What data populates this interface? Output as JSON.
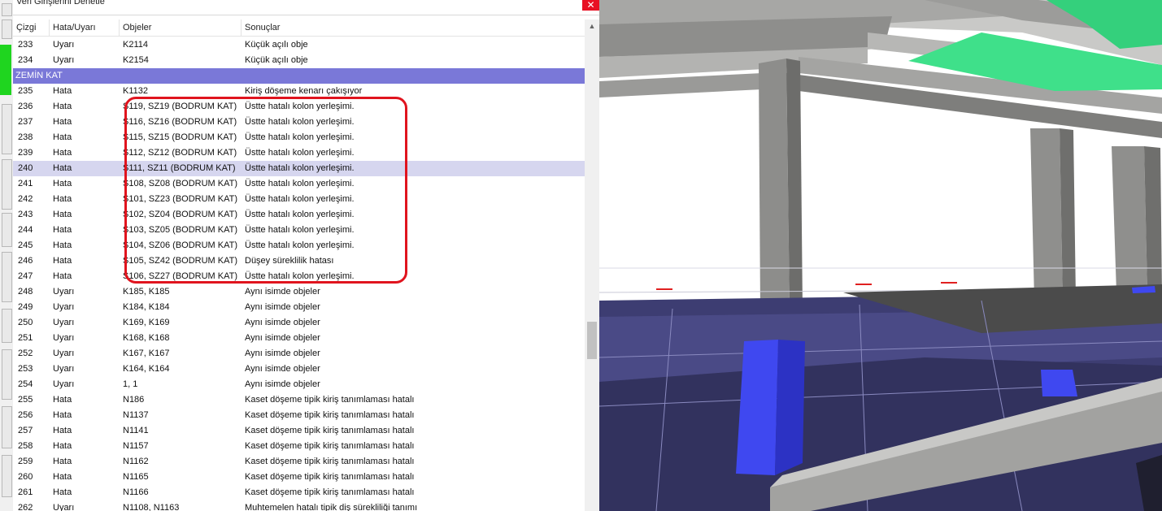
{
  "window": {
    "title": "Veri Girişlerini Denetle",
    "close_glyph": "✕"
  },
  "columns": [
    "Çizgi",
    "Hata/Uyarı",
    "Objeler",
    "Sonuçlar"
  ],
  "rows": [
    {
      "no": "233",
      "type": "Uyarı",
      "objects": "K2114",
      "result": "Küçük açılı obje"
    },
    {
      "no": "234",
      "type": "Uyarı",
      "objects": "K2154",
      "result": "Küçük açılı obje"
    },
    {
      "section": "ZEMİN KAT"
    },
    {
      "no": "235",
      "type": "Hata",
      "objects": "K1132",
      "result": "Kiriş döşeme kenarı çakışıyor"
    },
    {
      "no": "236",
      "type": "Hata",
      "objects": "S119, SZ19 (BODRUM  KAT)",
      "result": "Üstte hatalı kolon yerleşimi."
    },
    {
      "no": "237",
      "type": "Hata",
      "objects": "S116, SZ16 (BODRUM  KAT)",
      "result": "Üstte hatalı kolon yerleşimi."
    },
    {
      "no": "238",
      "type": "Hata",
      "objects": "S115, SZ15 (BODRUM  KAT)",
      "result": "Üstte hatalı kolon yerleşimi."
    },
    {
      "no": "239",
      "type": "Hata",
      "objects": "S112, SZ12 (BODRUM  KAT)",
      "result": "Üstte hatalı kolon yerleşimi."
    },
    {
      "no": "240",
      "type": "Hata",
      "objects": "S111, SZ11 (BODRUM  KAT)",
      "result": "Üstte hatalı kolon yerleşimi.",
      "selected": true
    },
    {
      "no": "241",
      "type": "Hata",
      "objects": "S108, SZ08 (BODRUM  KAT)",
      "result": "Üstte hatalı kolon yerleşimi."
    },
    {
      "no": "242",
      "type": "Hata",
      "objects": "S101, SZ23 (BODRUM  KAT)",
      "result": "Üstte hatalı kolon yerleşimi."
    },
    {
      "no": "243",
      "type": "Hata",
      "objects": "S102, SZ04 (BODRUM  KAT)",
      "result": "Üstte hatalı kolon yerleşimi."
    },
    {
      "no": "244",
      "type": "Hata",
      "objects": "S103, SZ05 (BODRUM  KAT)",
      "result": "Üstte hatalı kolon yerleşimi."
    },
    {
      "no": "245",
      "type": "Hata",
      "objects": "S104, SZ06 (BODRUM  KAT)",
      "result": "Üstte hatalı kolon yerleşimi."
    },
    {
      "no": "246",
      "type": "Hata",
      "objects": "S105, SZ42 (BODRUM  KAT)",
      "result": "Düşey süreklilik hatası"
    },
    {
      "no": "247",
      "type": "Hata",
      "objects": "S106, SZ27 (BODRUM  KAT)",
      "result": "Üstte hatalı kolon yerleşimi."
    },
    {
      "no": "248",
      "type": "Uyarı",
      "objects": "K185, K185",
      "result": "Aynı isimde objeler"
    },
    {
      "no": "249",
      "type": "Uyarı",
      "objects": "K184, K184",
      "result": "Aynı isimde objeler"
    },
    {
      "no": "250",
      "type": "Uyarı",
      "objects": "K169, K169",
      "result": "Aynı isimde objeler"
    },
    {
      "no": "251",
      "type": "Uyarı",
      "objects": "K168, K168",
      "result": "Aynı isimde objeler"
    },
    {
      "no": "252",
      "type": "Uyarı",
      "objects": "K167, K167",
      "result": "Aynı isimde objeler"
    },
    {
      "no": "253",
      "type": "Uyarı",
      "objects": "K164, K164",
      "result": "Aynı isimde objeler"
    },
    {
      "no": "254",
      "type": "Uyarı",
      "objects": "1, 1",
      "result": "Aynı isimde objeler"
    },
    {
      "no": "255",
      "type": "Hata",
      "objects": "N186",
      "result": "Kaset döşeme tipik kiriş tanımlaması hatalı"
    },
    {
      "no": "256",
      "type": "Hata",
      "objects": "N1137",
      "result": "Kaset döşeme tipik kiriş tanımlaması hatalı"
    },
    {
      "no": "257",
      "type": "Hata",
      "objects": "N1141",
      "result": "Kaset döşeme tipik kiriş tanımlaması hatalı"
    },
    {
      "no": "258",
      "type": "Hata",
      "objects": "N1157",
      "result": "Kaset döşeme tipik kiriş tanımlaması hatalı"
    },
    {
      "no": "259",
      "type": "Hata",
      "objects": "N1162",
      "result": "Kaset döşeme tipik kiriş tanımlaması hatalı"
    },
    {
      "no": "260",
      "type": "Hata",
      "objects": "N1165",
      "result": "Kaset döşeme tipik kiriş tanımlaması hatalı"
    },
    {
      "no": "261",
      "type": "Hata",
      "objects": "N1166",
      "result": "Kaset döşeme tipik kiriş tanımlaması hatalı"
    },
    {
      "no": "262",
      "type": "Uyarı",
      "objects": "N1108, N1163",
      "result": "Muhtemelen hatalı tipik diş sürekliliği tanımı"
    }
  ],
  "colors": {
    "section_bg": "#7a78d8",
    "selected_bg": "#d6d6ef",
    "highlight_box": "#e0141e",
    "concrete": "#9a9a98",
    "green_slab": "#3fe08a",
    "blue_column": "#3f48f0"
  }
}
